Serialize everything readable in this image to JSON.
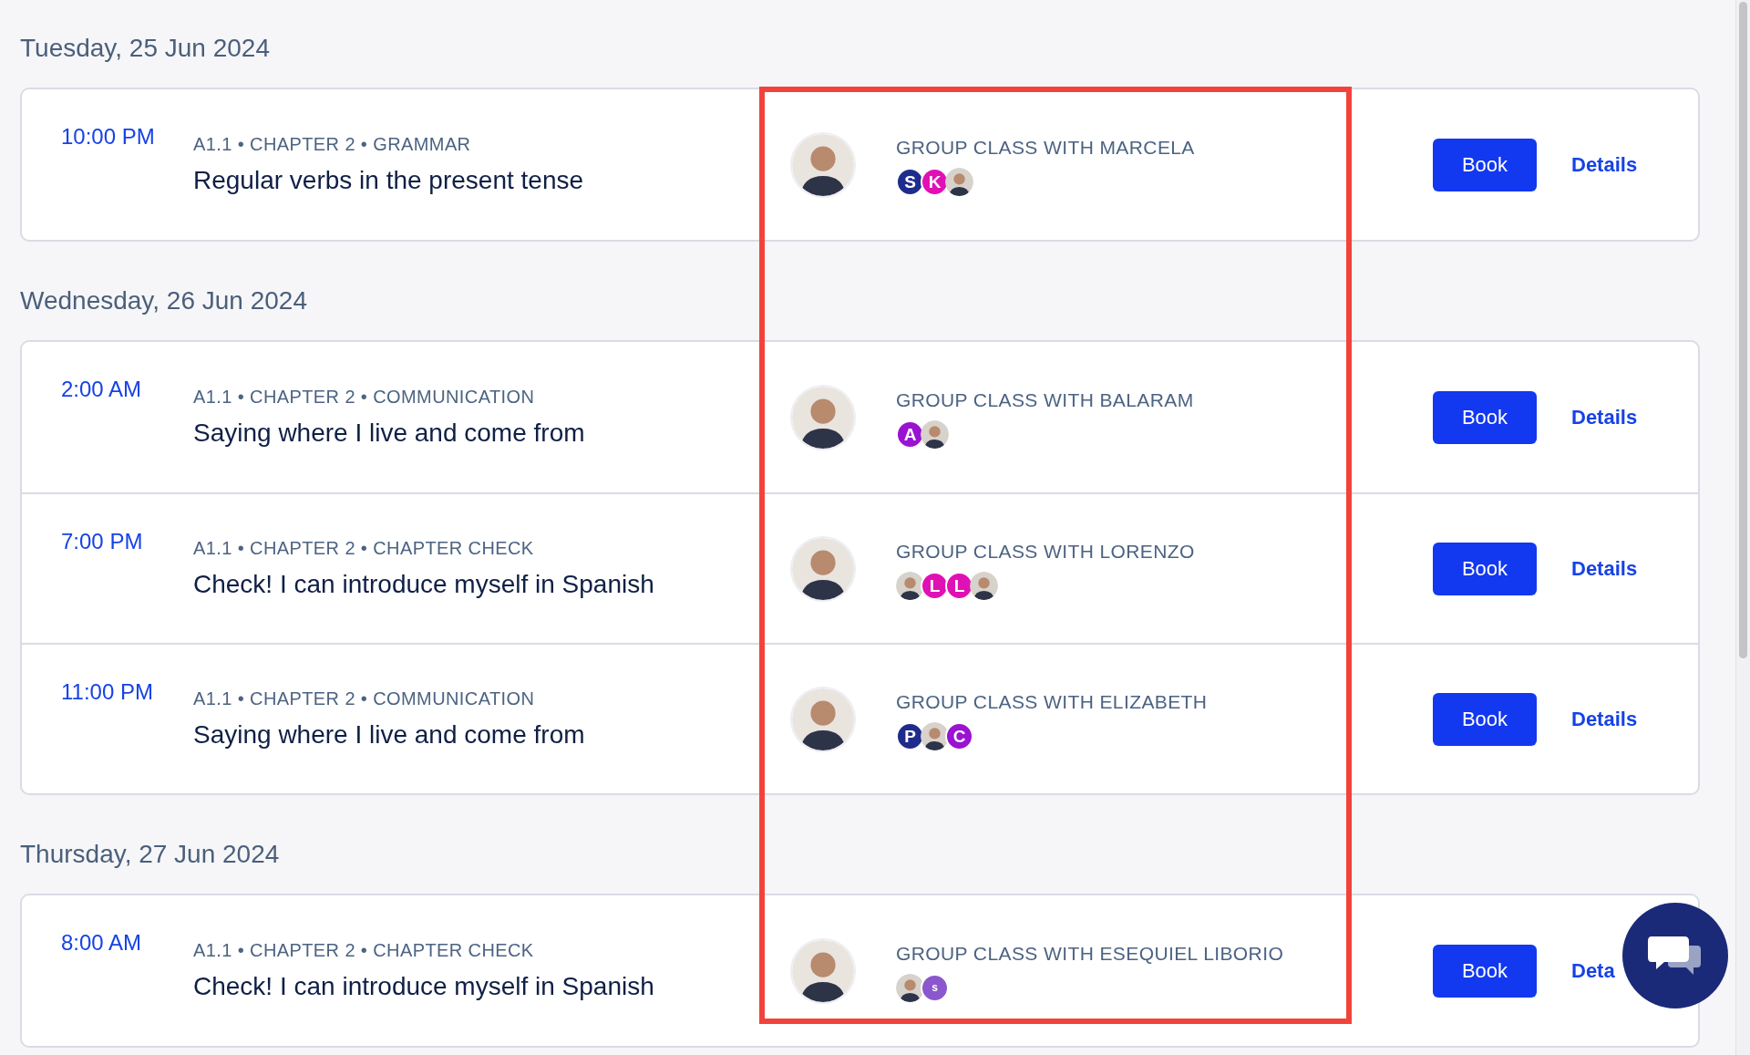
{
  "days": [
    {
      "label": "Tuesday, 25 Jun 2024",
      "sessions": [
        {
          "time": "10:00 PM",
          "meta": "A1.1 • CHAPTER 2 • GRAMMAR",
          "title": "Regular verbs in the present tense",
          "teacher": "GROUP CLASS WITH MARCELA",
          "participants": [
            {
              "kind": "letter",
              "initial": "S",
              "color": "#1e2c8c"
            },
            {
              "kind": "letter",
              "initial": "K",
              "color": "#e011b4"
            },
            {
              "kind": "photo"
            }
          ],
          "book": "Book",
          "details": "Details"
        }
      ]
    },
    {
      "label": "Wednesday, 26 Jun 2024",
      "sessions": [
        {
          "time": "2:00 AM",
          "meta": "A1.1 • CHAPTER 2 • COMMUNICATION",
          "title": "Saying where I live and come from",
          "teacher": "GROUP CLASS WITH BALARAM",
          "participants": [
            {
              "kind": "letter",
              "initial": "A",
              "color": "#9a12d2"
            },
            {
              "kind": "photo"
            }
          ],
          "book": "Book",
          "details": "Details"
        },
        {
          "time": "7:00 PM",
          "meta": "A1.1 • CHAPTER 2 • CHAPTER CHECK",
          "title": "Check! I can introduce myself in Spanish",
          "teacher": "GROUP CLASS WITH LORENZO",
          "participants": [
            {
              "kind": "photo"
            },
            {
              "kind": "letter",
              "initial": "L",
              "color": "#e011b4"
            },
            {
              "kind": "letter",
              "initial": "L",
              "color": "#e011b4"
            },
            {
              "kind": "photo"
            }
          ],
          "book": "Book",
          "details": "Details"
        },
        {
          "time": "11:00 PM",
          "meta": "A1.1 • CHAPTER 2 • COMMUNICATION",
          "title": "Saying where I live and come from",
          "teacher": "GROUP CLASS WITH ELIZABETH",
          "participants": [
            {
              "kind": "letter",
              "initial": "P",
              "color": "#1e2c8c"
            },
            {
              "kind": "photo"
            },
            {
              "kind": "letter",
              "initial": "C",
              "color": "#9a12d2"
            }
          ],
          "book": "Book",
          "details": "Details"
        }
      ]
    },
    {
      "label": "Thursday, 27 Jun 2024",
      "sessions": [
        {
          "time": "8:00 AM",
          "meta": "A1.1 • CHAPTER 2 • CHAPTER CHECK",
          "title": "Check! I can introduce myself in Spanish",
          "teacher": "GROUP CLASS WITH ESEQUIEL LIBORIO",
          "participants": [
            {
              "kind": "photo"
            },
            {
              "kind": "small-letter",
              "initial": "s",
              "color": "#8a58cc"
            }
          ],
          "book": "Book",
          "details": "Deta"
        }
      ]
    }
  ]
}
